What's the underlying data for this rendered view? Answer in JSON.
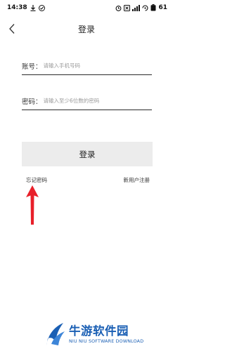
{
  "status_bar": {
    "time": "14:38",
    "battery": "61"
  },
  "header": {
    "title": "登录"
  },
  "form": {
    "account_label": "账号：",
    "account_placeholder": "请输入手机号码",
    "account_value": "",
    "password_label": "密码：",
    "password_placeholder": "请输入至少6位数的密码",
    "password_value": ""
  },
  "login_button_label": "登录",
  "links": {
    "forgot_password": "忘记密码",
    "register": "新用户注册"
  },
  "watermark": {
    "title": "牛游软件园",
    "subtitle": "NIU NIU SOFTWARE DOWNLOAD"
  },
  "colors": {
    "annotation_arrow": "#e8202a",
    "watermark_blue": "#1a5fb4",
    "button_bg": "#ececec"
  }
}
